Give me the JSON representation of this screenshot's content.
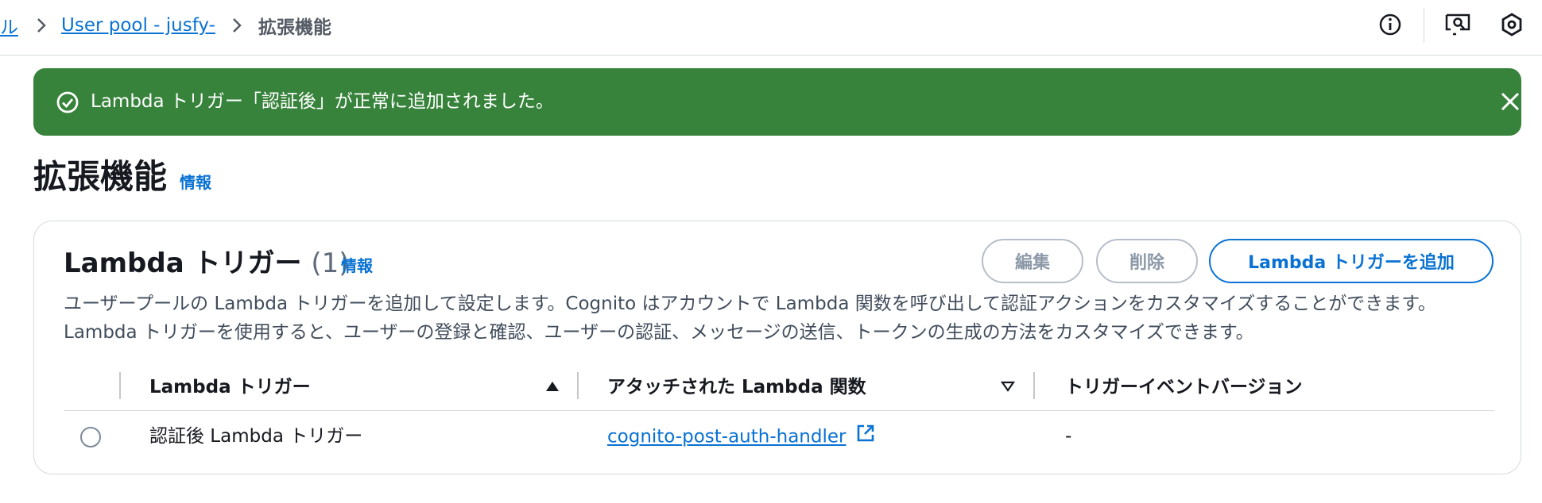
{
  "breadcrumb": {
    "items": [
      {
        "label": "ル",
        "link": true
      },
      {
        "label": "User pool - jusfy-",
        "link": true
      },
      {
        "label": "拡張機能",
        "link": false
      }
    ]
  },
  "top_icons": [
    "info-icon",
    "screen-search-icon",
    "settings-hex-icon"
  ],
  "flash": {
    "message": "Lambda トリガー「認証後」が正常に追加されました。",
    "status": "success",
    "color": "#37833b"
  },
  "page": {
    "title": "拡張機能",
    "info": "情報"
  },
  "section": {
    "title": "Lambda トリガー",
    "count": "(1)",
    "info": "情報",
    "buttons": {
      "edit": "編集",
      "delete": "削除",
      "add": "Lambda トリガーを追加"
    },
    "description": "ユーザープールの Lambda トリガーを追加して設定します。Cognito はアカウントで Lambda 関数を呼び出して認証アクションをカスタマイズすることができます。Lambda トリガーを使用すると、ユーザーの登録と確認、ユーザーの認証、メッセージの送信、トークンの生成の方法をカスタマイズできます。"
  },
  "table": {
    "columns": [
      "Lambda トリガー",
      "アタッチされた Lambda 関数",
      "トリガーイベントバージョン"
    ],
    "rows": [
      {
        "trigger": "認証後 Lambda トリガー",
        "function": "cognito-post-auth-handler",
        "version": "-"
      }
    ]
  },
  "colors": {
    "accent": "#0972d3",
    "success": "#37833b"
  }
}
